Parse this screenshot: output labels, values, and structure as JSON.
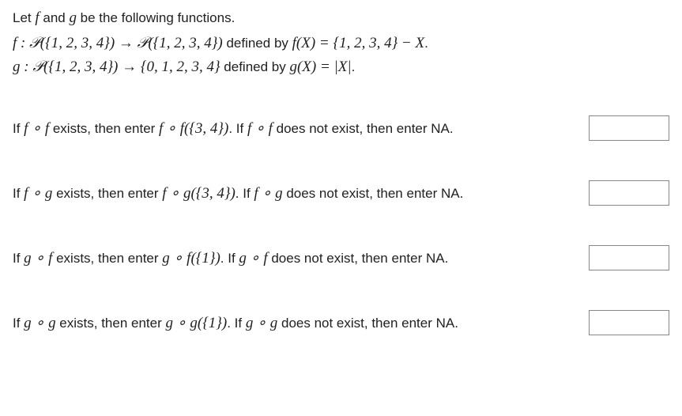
{
  "intro": {
    "prefix": "Let ",
    "f": "f",
    "and": " and ",
    "g": "g",
    "suffix": " be the following functions."
  },
  "def_f": {
    "lhs": "f : 𝒫({1, 2, 3, 4}) → 𝒫({1, 2, 3, 4})",
    "mid": " defined by ",
    "rhs": "f(X) = {1, 2, 3, 4} − X",
    "end": "."
  },
  "def_g": {
    "lhs": "g : 𝒫({1, 2, 3, 4}) → {0, 1, 2, 3, 4}",
    "mid": " defined by ",
    "rhs": "g(X) = |X|",
    "end": "."
  },
  "questions": {
    "q1": {
      "p1": "If ",
      "m1": "f ∘ f",
      "p2": " exists, then enter ",
      "m2": "f ∘ f({3, 4})",
      "p3": ".  If ",
      "m3": "f ∘ f",
      "p4": " does not exist, then enter NA."
    },
    "q2": {
      "p1": "If ",
      "m1": "f ∘ g",
      "p2": " exists, then enter ",
      "m2": "f ∘ g({3, 4})",
      "p3": ".  If ",
      "m3": "f ∘ g",
      "p4": " does not exist, then enter NA."
    },
    "q3": {
      "p1": "If ",
      "m1": "g ∘ f",
      "p2": " exists, then enter ",
      "m2": "g ∘ f({1})",
      "p3": ".  If ",
      "m3": "g ∘ f",
      "p4": " does not exist, then enter NA."
    },
    "q4": {
      "p1": "If ",
      "m1": "g ∘ g",
      "p2": " exists, then enter ",
      "m2": "g ∘ g({1})",
      "p3": ".  If ",
      "m3": "g ∘ g",
      "p4": " does not exist, then enter NA."
    }
  }
}
